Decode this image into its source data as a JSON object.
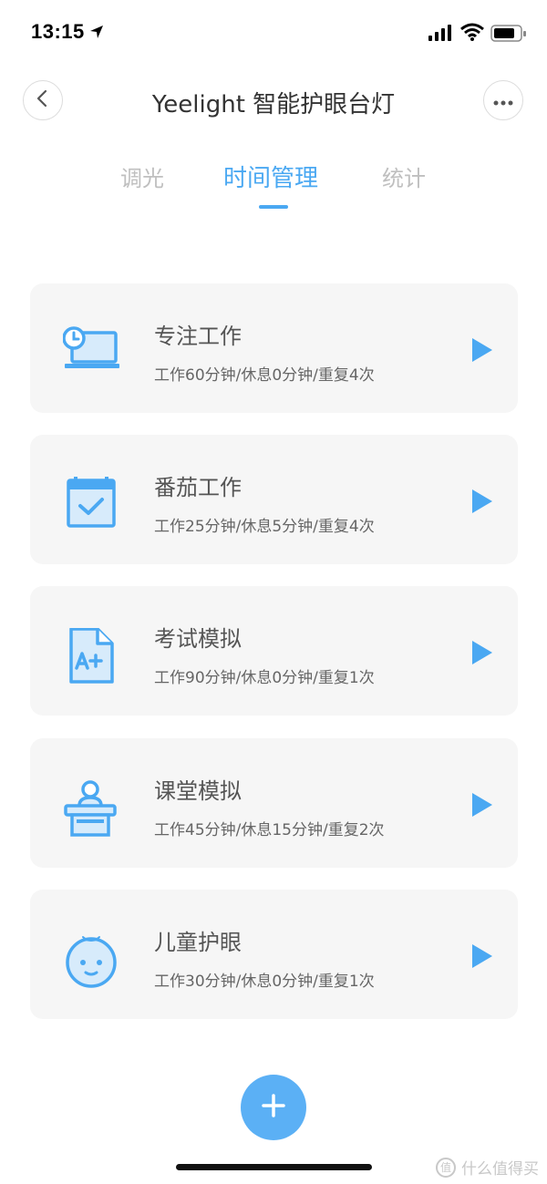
{
  "status_bar": {
    "time": "13:15",
    "icons": [
      "location-arrow-icon",
      "signal-icon",
      "wifi-icon",
      "battery-icon"
    ]
  },
  "header": {
    "title": "Yeelight 智能护眼台灯",
    "back_icon": "chevron-left-icon",
    "more_icon": "more-dots-icon"
  },
  "tabs": [
    {
      "label": "调光",
      "active": false
    },
    {
      "label": "时间管理",
      "active": true
    },
    {
      "label": "统计",
      "active": false
    }
  ],
  "modes": [
    {
      "name": "专注工作",
      "desc": "工作60分钟/休息0分钟/重复4次",
      "icon": "laptop-clock-icon"
    },
    {
      "name": "番茄工作",
      "desc": "工作25分钟/休息5分钟/重复4次",
      "icon": "calendar-check-icon"
    },
    {
      "name": "考试模拟",
      "desc": "工作90分钟/休息0分钟/重复1次",
      "icon": "exam-paper-icon"
    },
    {
      "name": "课堂模拟",
      "desc": "工作45分钟/休息15分钟/重复2次",
      "icon": "teacher-podium-icon"
    },
    {
      "name": "儿童护眼",
      "desc": "工作30分钟/休息0分钟/重复1次",
      "icon": "baby-face-icon"
    }
  ],
  "add_button": {
    "icon": "plus-icon"
  },
  "watermark": {
    "text": "什么值得买"
  },
  "colors": {
    "accent": "#4aa8f2",
    "card_bg": "#f6f6f6",
    "inactive_tab": "#bfbfbf",
    "add_button": "#5bb0f5"
  }
}
